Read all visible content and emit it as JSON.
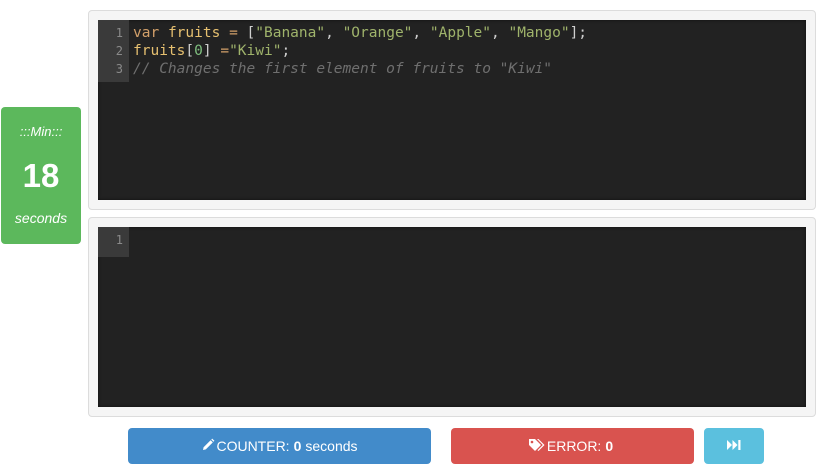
{
  "timer": {
    "label": ":::Min:::",
    "value": "18",
    "unit": "seconds"
  },
  "editor_top": {
    "line_numbers": [
      "1",
      "2",
      "3"
    ],
    "lines": [
      [
        {
          "t": "var",
          "c": "kw"
        },
        {
          "t": " ",
          "c": "punc"
        },
        {
          "t": "fruits",
          "c": "var"
        },
        {
          "t": " ",
          "c": "punc"
        },
        {
          "t": "=",
          "c": "op"
        },
        {
          "t": " [",
          "c": "punc"
        },
        {
          "t": "\"Banana\"",
          "c": "str"
        },
        {
          "t": ", ",
          "c": "punc"
        },
        {
          "t": "\"Orange\"",
          "c": "str"
        },
        {
          "t": ", ",
          "c": "punc"
        },
        {
          "t": "\"Apple\"",
          "c": "str"
        },
        {
          "t": ", ",
          "c": "punc"
        },
        {
          "t": "\"Mango\"",
          "c": "str"
        },
        {
          "t": "];",
          "c": "punc"
        }
      ],
      [
        {
          "t": "fruits",
          "c": "var"
        },
        {
          "t": "[",
          "c": "punc"
        },
        {
          "t": "0",
          "c": "num"
        },
        {
          "t": "] ",
          "c": "punc"
        },
        {
          "t": "=",
          "c": "op"
        },
        {
          "t": "\"Kiwi\"",
          "c": "str"
        },
        {
          "t": ";",
          "c": "punc"
        }
      ],
      [
        {
          "t": "// Changes the first element of fruits to \"Kiwi\"",
          "c": "cmt"
        }
      ]
    ]
  },
  "editor_bottom": {
    "line_numbers": [
      "1"
    ],
    "content": ""
  },
  "buttons": {
    "counter_prefix": "COUNTER:",
    "counter_value": "0",
    "counter_suffix": "seconds",
    "error_prefix": "ERROR:",
    "error_value": "0"
  },
  "icons": {
    "counter": "pencil-icon",
    "error": "tag-icon",
    "next": "fast-forward-icon"
  },
  "colors": {
    "timer_bg": "#5cb85c",
    "counter_bg": "#428bca",
    "error_bg": "#d9534f",
    "next_bg": "#5bc0de",
    "editor_bg": "#222222"
  }
}
